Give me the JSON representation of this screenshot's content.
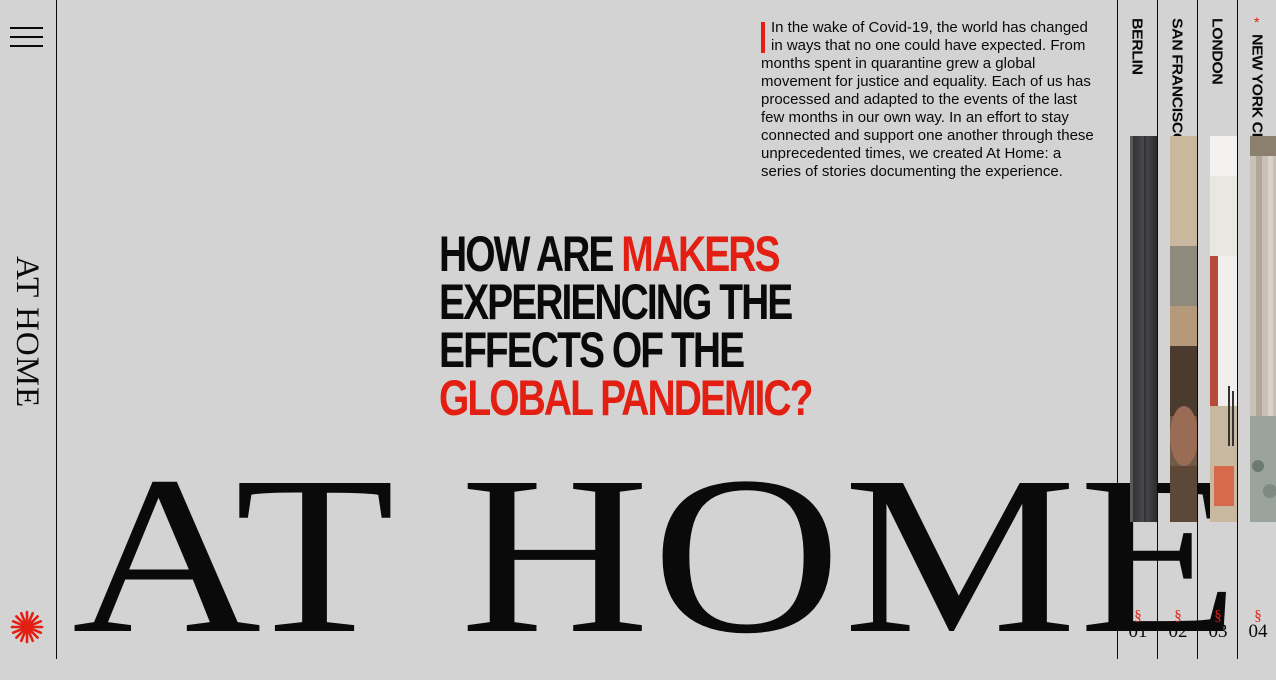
{
  "sidebar": {
    "menu_icon": "hamburger-menu-icon",
    "title": "AT HOME",
    "logo_icon": "asterisk-star-icon"
  },
  "intro": {
    "text": "In the wake of Covid-19, the world has changed in ways that no one could have expected. From months spent in quarantine grew a global movement for justice and equality. Each of us has processed and adapted to the events of the last few months in our own way. In an effort to stay connected and support one another through these unprecedented times, we created At Home: a series of stories documenting the experience."
  },
  "question": {
    "line1_a": "HOW ARE ",
    "line1_b": "MAKERS",
    "line2": "EXPERIENCING THE",
    "line3": "EFFECTS OF THE",
    "line4": "GLOBAL PANDEMIC?"
  },
  "hero": {
    "title": "AT HOME"
  },
  "cities": [
    {
      "name": "BERLIN",
      "section": "§",
      "number": "01"
    },
    {
      "name": "SAN FRANCISCO",
      "section": "§",
      "number": "02"
    },
    {
      "name": "LONDON",
      "section": "§",
      "number": "03"
    },
    {
      "name": "NEW YORK CITY",
      "section": "§",
      "number": "04",
      "active_marker": "*"
    }
  ],
  "colors": {
    "background": "#d3d3d3",
    "accent": "#e21f12",
    "ink": "#0a0a0a"
  }
}
